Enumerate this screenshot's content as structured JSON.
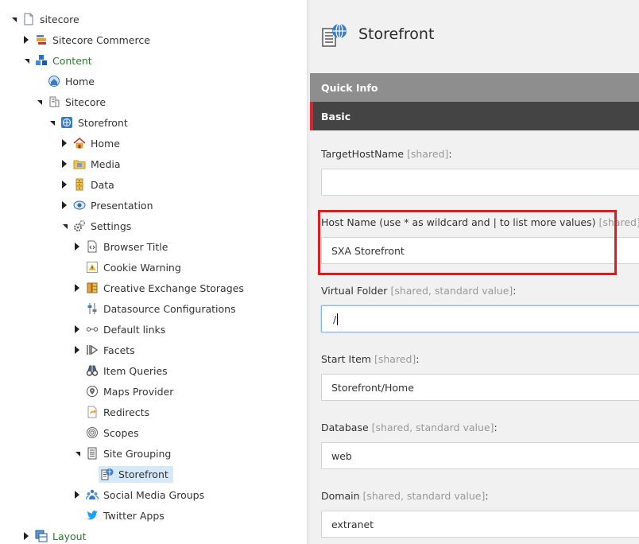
{
  "tree": {
    "root_label": "sitecore",
    "commerce_label": "Sitecore Commerce",
    "content_label": "Content",
    "home_label": "Home",
    "sitecore_label": "Sitecore",
    "storefront_label": "Storefront",
    "sf_home_label": "Home",
    "media_label": "Media",
    "data_label": "Data",
    "presentation_label": "Presentation",
    "settings_label": "Settings",
    "browser_title_label": "Browser Title",
    "cookie_warning_label": "Cookie Warning",
    "ce_storages_label": "Creative Exchange Storages",
    "datasource_conf_label": "Datasource Configurations",
    "default_links_label": "Default links",
    "facets_label": "Facets",
    "item_queries_label": "Item Queries",
    "maps_provider_label": "Maps Provider",
    "redirects_label": "Redirects",
    "scopes_label": "Scopes",
    "site_grouping_label": "Site Grouping",
    "sg_storefront_label": "Storefront",
    "social_media_label": "Social Media Groups",
    "twitter_label": "Twitter Apps",
    "layout_label": "Layout"
  },
  "editor": {
    "title": "Storefront",
    "quick_info_label": "Quick Info",
    "basic_label": "Basic",
    "fields": {
      "target_host": {
        "label": "TargetHostName",
        "meta": "[shared]",
        "suffix": ":",
        "value": ""
      },
      "host_name": {
        "label": "Host Name (use * as wildcard and | to list more values)",
        "meta": "[shared]",
        "suffix": ":",
        "value": "SXA Storefront"
      },
      "virtual_folder": {
        "label": "Virtual Folder",
        "meta": "[shared, standard value]",
        "suffix": ":",
        "value": "/"
      },
      "start_item": {
        "label": "Start Item",
        "meta": "[shared]",
        "suffix": ":",
        "value": "Storefront/Home"
      },
      "database": {
        "label": "Database",
        "meta": "[shared, standard value]",
        "suffix": ":",
        "value": "web"
      },
      "domain": {
        "label": "Domain",
        "meta": "[shared, standard value]",
        "suffix": ":",
        "value": "extranet"
      }
    }
  },
  "colors": {
    "highlight": "#e01b1b",
    "selection": "#d6e9f8",
    "section_dark": "#444444",
    "section_grey": "#8e8e8e",
    "accent_red": "#d9232d"
  }
}
